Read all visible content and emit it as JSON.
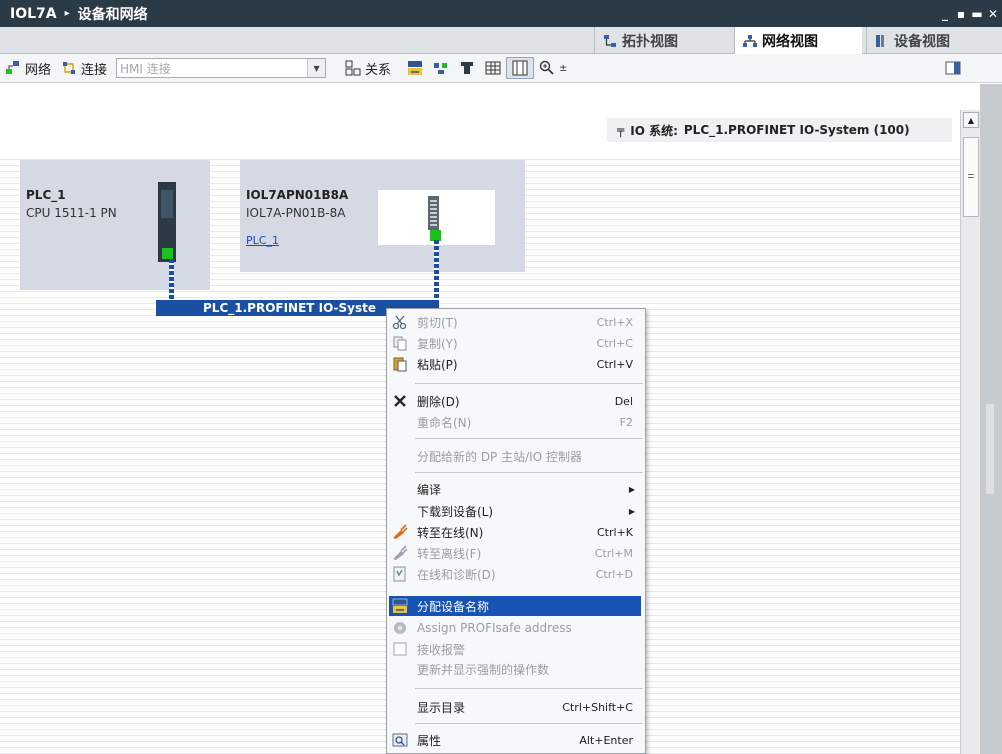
{
  "title": {
    "project": "IOL7A",
    "separator": "▸",
    "section": "设备和网络"
  },
  "window_buttons": [
    "_",
    "▪",
    "▬",
    "✕"
  ],
  "view_tabs": [
    {
      "label": "拓扑视图",
      "icon": "topology-icon"
    },
    {
      "label": "网络视图",
      "icon": "network-icon",
      "active": true
    },
    {
      "label": "设备视图",
      "icon": "device-view-icon"
    }
  ],
  "toolbar": {
    "network_label": "网络",
    "connections_label": "连接",
    "connection_type": "HMI 连接",
    "relations_label": "关系"
  },
  "io_system_label": {
    "prefix": "IO 系统:",
    "value": "PLC_1.PROFINET IO-System (100)"
  },
  "devices": {
    "plc": {
      "name": "PLC_1",
      "type": "CPU 1511-1 PN"
    },
    "io_device": {
      "name": "IOL7APN01B8A",
      "type": "IOL7A-PN01B-8A",
      "controller_link": "PLC_1"
    }
  },
  "network_label": "PLC_1.PROFINET IO-Syste",
  "context_menu": [
    {
      "label": "剪切(T)",
      "shortcut": "Ctrl+X",
      "icon": "scissors-icon",
      "disabled": true
    },
    {
      "label": "复制(Y)",
      "shortcut": "Ctrl+C",
      "icon": "copy-icon",
      "disabled": true
    },
    {
      "label": "粘贴(P)",
      "shortcut": "Ctrl+V",
      "icon": "paste-icon",
      "disabled": false
    },
    {
      "label": "删除(D)",
      "shortcut": "Del",
      "icon": "delete-icon",
      "disabled": false
    },
    {
      "label": "重命名(N)",
      "shortcut": "F2",
      "icon": "",
      "disabled": true
    },
    {
      "label": "分配给新的 DP 主站/IO 控制器",
      "shortcut": "",
      "icon": "",
      "disabled": true
    },
    {
      "label": "编译",
      "shortcut": "",
      "icon": "",
      "disabled": false,
      "submenu": true
    },
    {
      "label": "下载到设备(L)",
      "shortcut": "",
      "icon": "",
      "disabled": false,
      "submenu": true
    },
    {
      "label": "转至在线(N)",
      "shortcut": "Ctrl+K",
      "icon": "go-online-icon",
      "disabled": false
    },
    {
      "label": "转至离线(F)",
      "shortcut": "Ctrl+M",
      "icon": "go-offline-icon",
      "disabled": true
    },
    {
      "label": "在线和诊断(D)",
      "shortcut": "Ctrl+D",
      "icon": "diagnostics-icon",
      "disabled": true
    },
    {
      "label": "分配设备名称",
      "shortcut": "",
      "icon": "assign-name-icon",
      "disabled": false,
      "highlighted": true
    },
    {
      "label": "Assign PROFIsafe address",
      "shortcut": "",
      "icon": "profisafe-icon",
      "disabled": true
    },
    {
      "label": "接收报警",
      "shortcut": "",
      "icon": "checkbox-icon",
      "disabled": true
    },
    {
      "label": "更新并显示强制的操作数",
      "shortcut": "",
      "icon": "",
      "disabled": true
    },
    {
      "label": "显示目录",
      "shortcut": "Ctrl+Shift+C",
      "icon": "",
      "disabled": false
    },
    {
      "label": "属性",
      "shortcut": "Alt+Enter",
      "icon": "properties-icon",
      "disabled": false
    }
  ],
  "colors": {
    "titlebar": "#2b3a47",
    "highlight": "#1753b5",
    "network": "#1b4fa3",
    "port": "#1ac21a"
  }
}
